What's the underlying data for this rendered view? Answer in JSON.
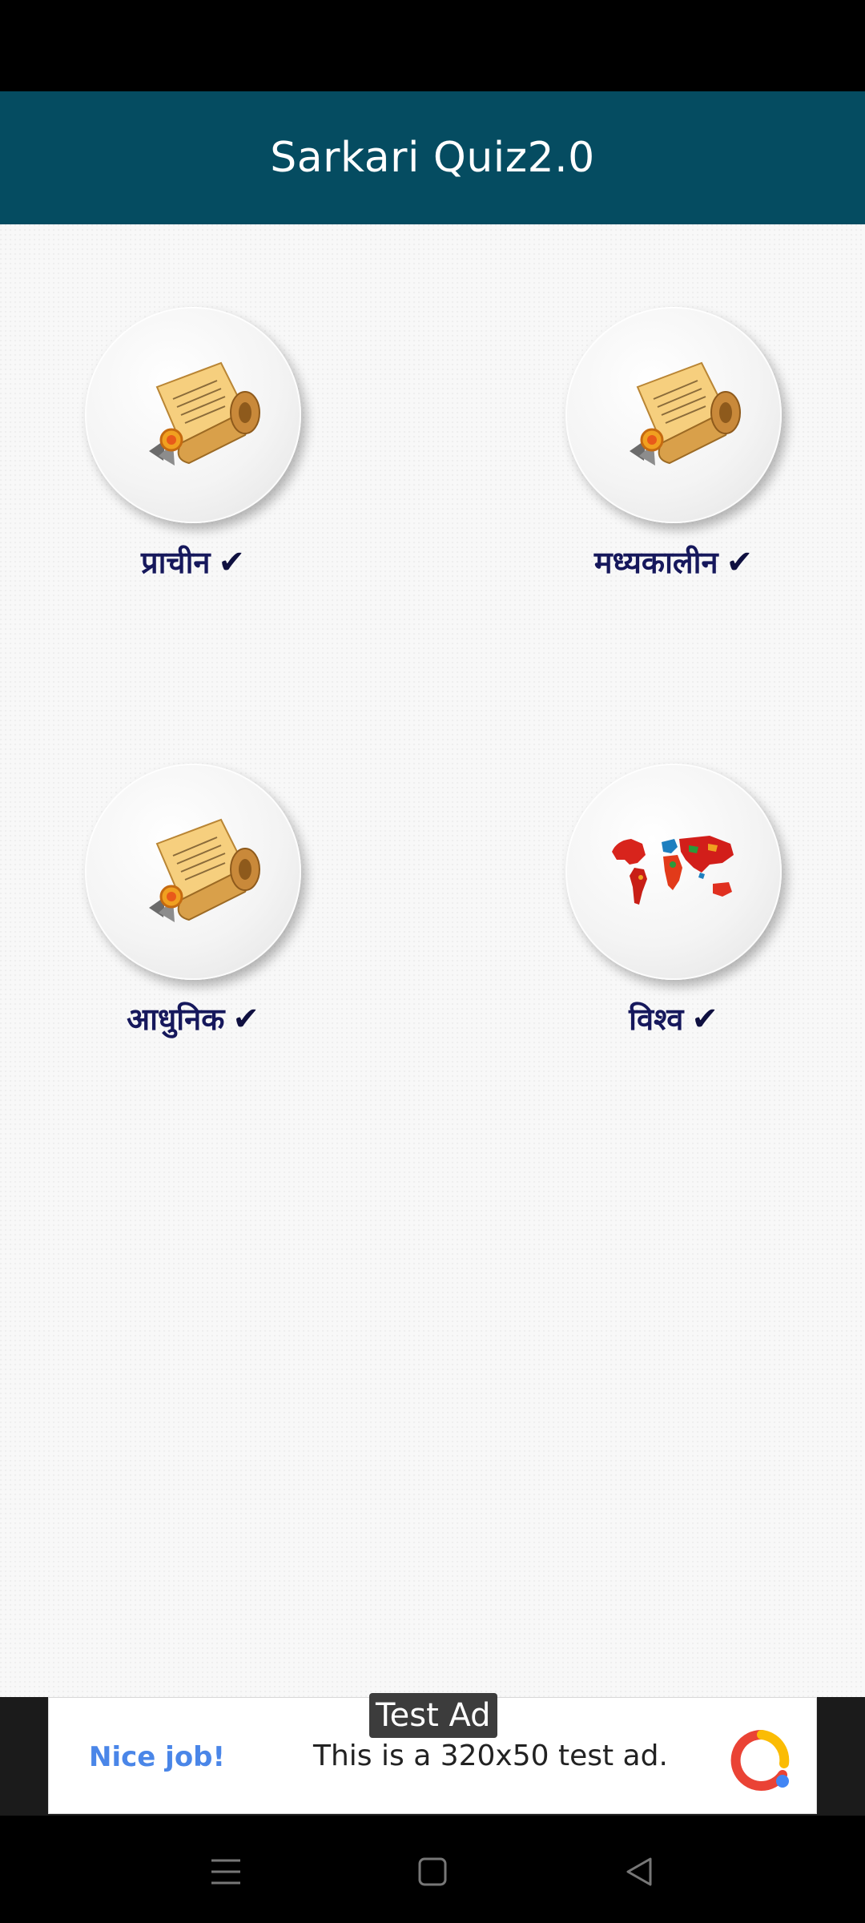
{
  "app_bar": {
    "title": "Sarkari Quiz2.0"
  },
  "categories": [
    {
      "label": "प्राचीन",
      "check": "✔",
      "icon": "scroll-icon"
    },
    {
      "label": "मध्यकालीन",
      "check": "✔",
      "icon": "scroll-icon"
    },
    {
      "label": "आधुनिक",
      "check": "✔",
      "icon": "scroll-icon"
    },
    {
      "label": "विश्व",
      "check": "✔",
      "icon": "world-map-icon"
    }
  ],
  "ad": {
    "badge": "Test Ad",
    "headline": "Nice job!",
    "body": "This is a 320x50 test ad."
  },
  "colors": {
    "app_bar": "#054c61",
    "label": "#16185c",
    "ad_headline": "#4a86e8"
  },
  "nav": {
    "icons": [
      "menu-icon",
      "home-icon",
      "back-icon"
    ]
  }
}
